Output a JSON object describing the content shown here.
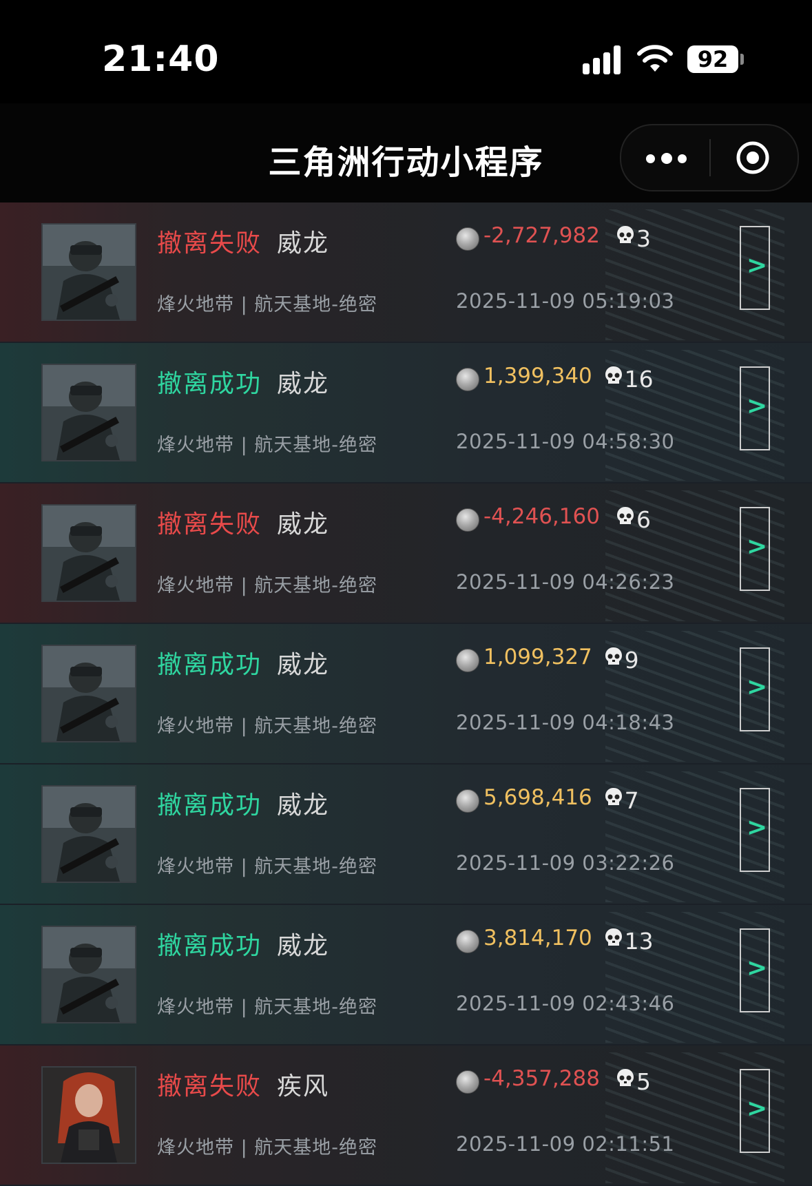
{
  "status_bar": {
    "time": "21:40",
    "battery": "92"
  },
  "nav": {
    "title": "三角洲行动小程序"
  },
  "colors": {
    "fail": "#e84a4a",
    "success": "#2fd6a0",
    "negative_value": "#e05252",
    "positive_value": "#f0c060"
  },
  "records": [
    {
      "status": "撤离失败",
      "result": "fail",
      "operator": "威龙",
      "map": "烽火地带 | 航天基地-绝密",
      "value": "-2,727,982",
      "kills": "3",
      "time": "2025-11-09 05:19:03"
    },
    {
      "status": "撤离成功",
      "result": "success",
      "operator": "威龙",
      "map": "烽火地带 | 航天基地-绝密",
      "value": "1,399,340",
      "kills": "16",
      "time": "2025-11-09 04:58:30"
    },
    {
      "status": "撤离失败",
      "result": "fail",
      "operator": "威龙",
      "map": "烽火地带 | 航天基地-绝密",
      "value": "-4,246,160",
      "kills": "6",
      "time": "2025-11-09 04:26:23"
    },
    {
      "status": "撤离成功",
      "result": "success",
      "operator": "威龙",
      "map": "烽火地带 | 航天基地-绝密",
      "value": "1,099,327",
      "kills": "9",
      "time": "2025-11-09 04:18:43"
    },
    {
      "status": "撤离成功",
      "result": "success",
      "operator": "威龙",
      "map": "烽火地带 | 航天基地-绝密",
      "value": "5,698,416",
      "kills": "7",
      "time": "2025-11-09 03:22:26"
    },
    {
      "status": "撤离成功",
      "result": "success",
      "operator": "威龙",
      "map": "烽火地带 | 航天基地-绝密",
      "value": "3,814,170",
      "kills": "13",
      "time": "2025-11-09 02:43:46"
    },
    {
      "status": "撤离失败",
      "result": "fail",
      "operator": "疾风",
      "map": "烽火地带 | 航天基地-绝密",
      "value": "-4,357,288",
      "kills": "5",
      "time": "2025-11-09 02:11:51"
    }
  ],
  "icons": {
    "detail": "chevron-right-icon",
    "value": "coin-icon",
    "kills": "skull-icon",
    "more": "more-icon",
    "close": "target-icon"
  }
}
